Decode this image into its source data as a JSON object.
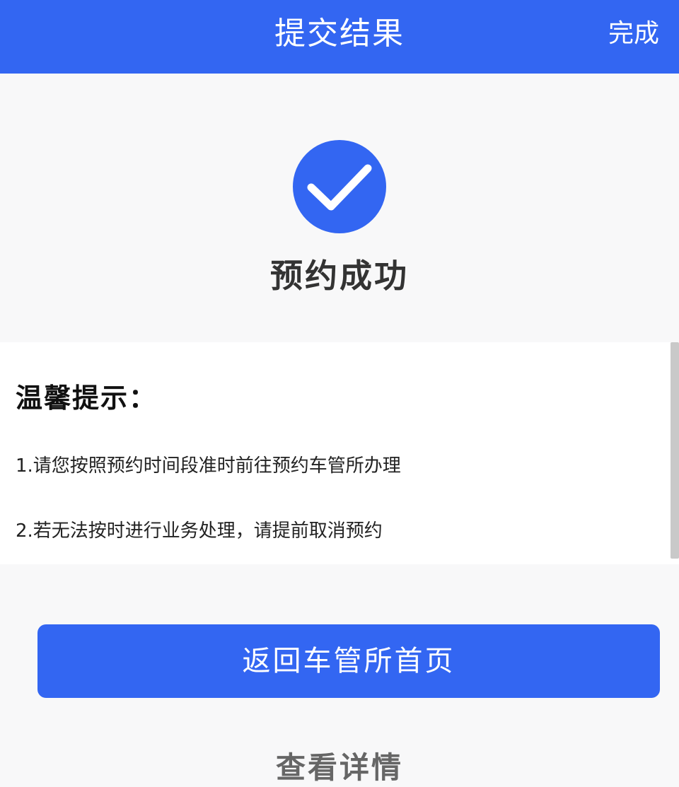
{
  "header": {
    "title": "提交结果",
    "done_label": "完成"
  },
  "result": {
    "icon": "check-circle-icon",
    "title": "预约成功"
  },
  "tips": {
    "heading": "温馨提示：",
    "items": [
      "1.请您按照预约时间段准时前往预约车管所办理",
      "2.若无法按时进行业务处理，请提前取消预约"
    ]
  },
  "actions": {
    "primary_label": "返回车管所首页",
    "secondary_label": "查看详情"
  },
  "colors": {
    "accent": "#3366f2",
    "background": "#f8f8f9",
    "panel": "#ffffff",
    "title_text": "#333333",
    "secondary_text": "#666666"
  }
}
